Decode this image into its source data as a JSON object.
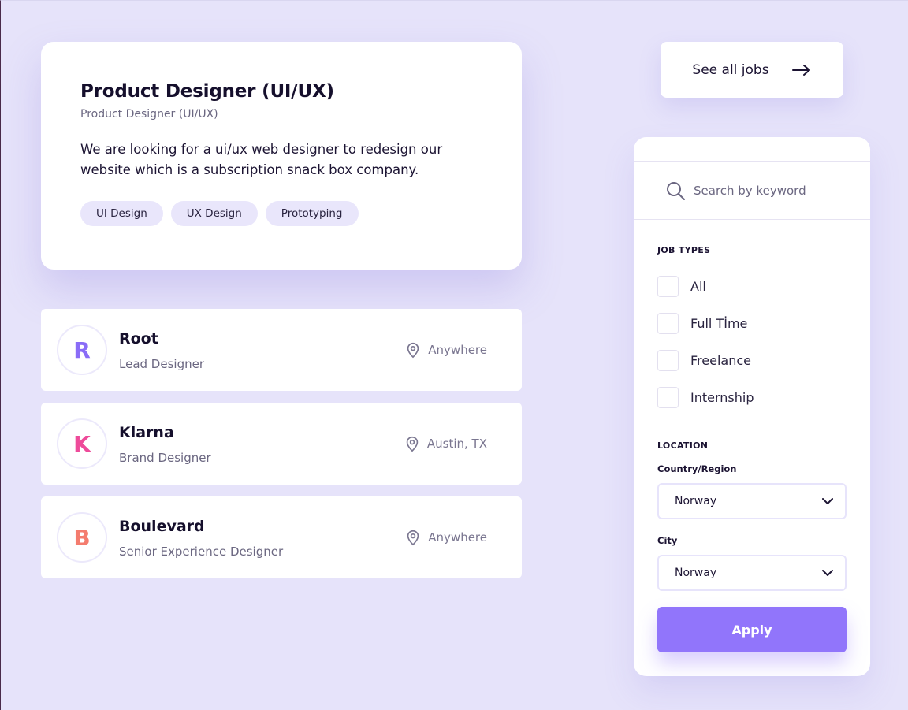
{
  "featured": {
    "title": "Product Designer (UI/UX)",
    "subtitle": "Product Designer (UI/UX)",
    "description": "We are looking for a ui/ux web designer to redesign our website which is a subscription snack box company.",
    "tags": [
      "UI Design",
      "UX Design",
      "Prototyping"
    ]
  },
  "jobs": [
    {
      "initial": "R",
      "initial_color": "#8a6cf7",
      "company": "Root",
      "role": "Lead Designer",
      "location": "Anywhere"
    },
    {
      "initial": "K",
      "initial_color": "#ee4b9a",
      "company": "Klarna",
      "role": "Brand Designer",
      "location": "Austin, TX"
    },
    {
      "initial": "B",
      "initial_color": "#f47c6e",
      "company": "Boulevard",
      "role": "Senior Experience Designer",
      "location": "Anywhere"
    }
  ],
  "see_all": {
    "label": "See all jobs",
    "icon": "arrow-right-icon"
  },
  "filter": {
    "search_placeholder": "Search by keyword",
    "job_types_label": "JOB TYPES",
    "job_types": [
      "All",
      "Full Tİme",
      "Freelance",
      "Internship"
    ],
    "location_label": "LOCATION",
    "country_label": "Country/Region",
    "country_value": "Norway",
    "city_label": "City",
    "city_value": "Norway",
    "apply_label": "Apply"
  },
  "colors": {
    "background": "#e6e3fa",
    "accent": "#9175fb",
    "tag_bg": "#e9e6fb"
  }
}
